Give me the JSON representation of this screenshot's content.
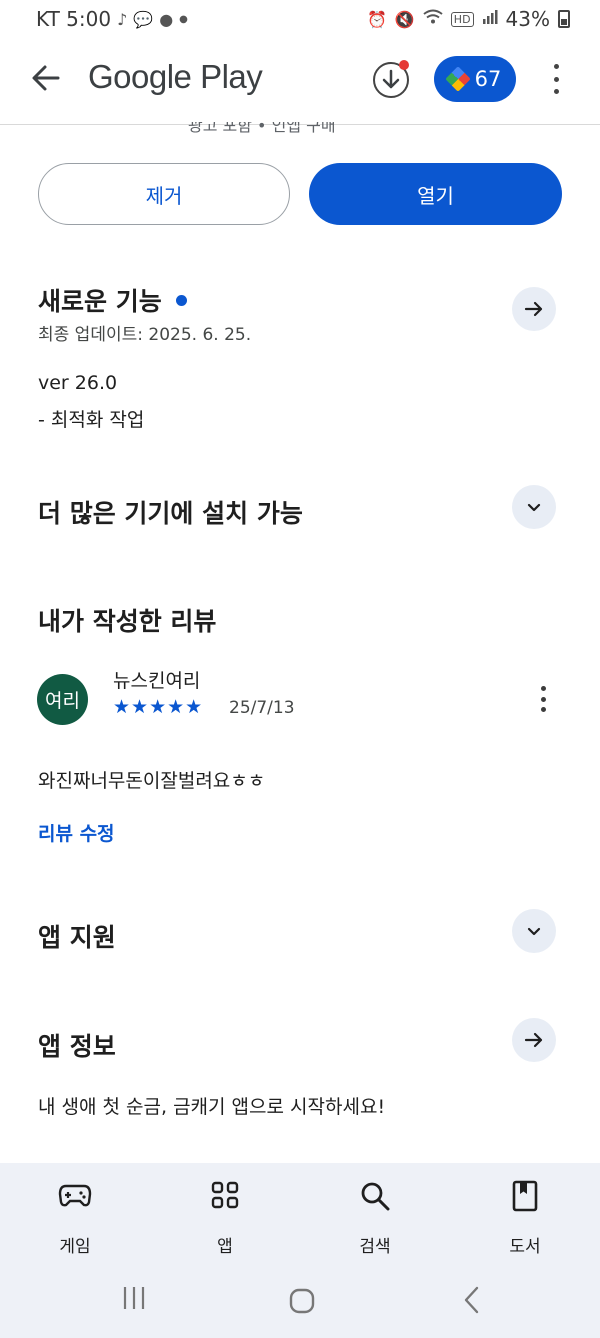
{
  "status_bar": {
    "carrier_time": "KT 5:00",
    "battery": "43%",
    "notif_icons": [
      "tiktok-icon",
      "kakaotalk-icon",
      "chat-icon",
      "dot-icon"
    ],
    "system_icons": [
      "alarm-icon",
      "mute-icon",
      "wifi-icon",
      "hd-icon",
      "signal-icon",
      "battery-icon"
    ]
  },
  "app_bar": {
    "title": "Google Play",
    "points": "67"
  },
  "truncated_text": "광고 포함 • 인앱 구매",
  "actions": {
    "remove_label": "제거",
    "open_label": "열기"
  },
  "whats_new": {
    "title": "새로운 기능",
    "updated": "최종 업데이트: 2025. 6. 25.",
    "version": "ver 26.0",
    "note": "- 최적화 작업"
  },
  "devices": {
    "title": "더 많은 기기에 설치 가능"
  },
  "my_review": {
    "title": "내가 작성한 리뷰",
    "avatar_text": "여리",
    "author": "뉴스킨여리",
    "rating": 5,
    "stars": "★★★★★",
    "date": "25/7/13",
    "text": "와진짜너무돈이잘벌려요ㅎㅎ",
    "edit_label": "리뷰 수정"
  },
  "app_support": {
    "title": "앱 지원"
  },
  "app_info": {
    "title": "앱 정보",
    "description": "내 생애 첫 순금, 금캐기 앱으로 시작하세요!"
  },
  "bottom_nav": {
    "items": [
      {
        "label": "게임",
        "icon": "gamepad-icon"
      },
      {
        "label": "앱",
        "icon": "apps-grid-icon"
      },
      {
        "label": "검색",
        "icon": "search-icon"
      },
      {
        "label": "도서",
        "icon": "book-icon"
      }
    ]
  },
  "colors": {
    "accent": "#0b57d0",
    "avatar_bg": "#115a43",
    "chip_bg": "#e8edf5",
    "nav_bg": "#eef1f7"
  }
}
